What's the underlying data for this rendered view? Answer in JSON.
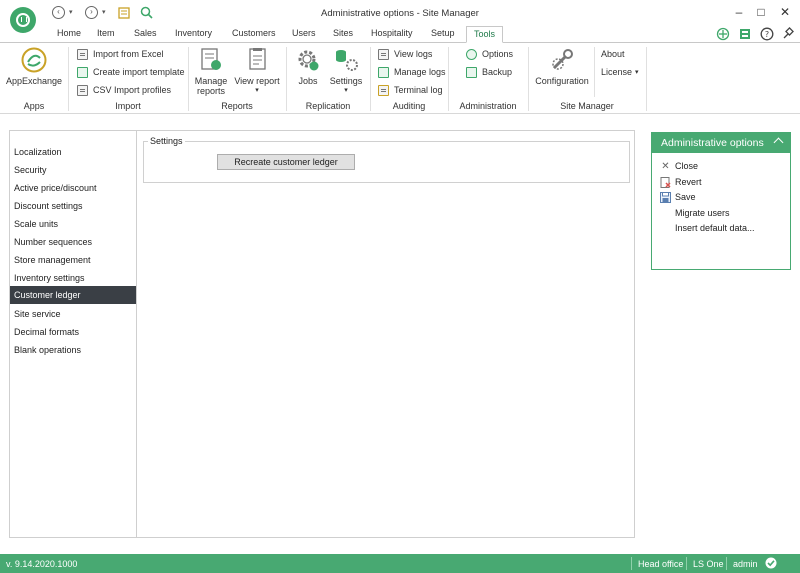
{
  "window": {
    "title": "Administrative options - Site Manager"
  },
  "ribbon": {
    "tabs": [
      "Home",
      "Item",
      "Sales",
      "Inventory",
      "Customers",
      "Users",
      "Sites",
      "Hospitality",
      "Setup",
      "Tools"
    ],
    "active_tab": "Tools",
    "groups": {
      "apps": {
        "label": "Apps",
        "appexchange": "AppExchange"
      },
      "import": {
        "label": "Import",
        "import_excel": "Import from Excel",
        "create_template": "Create import template",
        "csv_profiles": "CSV Import profiles"
      },
      "reports": {
        "label": "Reports",
        "manage_reports": "Manage\nreports",
        "manage_line1": "Manage",
        "manage_line2": "reports",
        "view_report": "View report"
      },
      "replication": {
        "label": "Replication",
        "jobs": "Jobs",
        "settings": "Settings"
      },
      "auditing": {
        "label": "Auditing",
        "view_logs": "View logs",
        "manage_logs": "Manage logs",
        "terminal_log": "Terminal log"
      },
      "administration": {
        "label": "Administration",
        "options": "Options",
        "backup": "Backup"
      },
      "site_manager": {
        "label": "Site Manager",
        "configuration": "Configuration",
        "about": "About",
        "license": "License"
      }
    }
  },
  "sidebar": {
    "items": [
      "Localization",
      "Security",
      "Active price/discount",
      "Discount settings",
      "Scale units",
      "Number sequences",
      "Store management",
      "Inventory settings",
      "Customer ledger",
      "Site service",
      "Decimal formats",
      "Blank operations"
    ],
    "active": "Customer ledger"
  },
  "content": {
    "group_title": "Settings",
    "recreate_button": "Recreate customer ledger"
  },
  "right_panel": {
    "title": "Administrative options",
    "actions": [
      "Close",
      "Revert",
      "Save",
      "Migrate users",
      "Insert default data..."
    ]
  },
  "status_bar": {
    "version": "v. 9.14.2020.1000",
    "site": "Head office",
    "product": "LS One",
    "user": "admin"
  },
  "colors": {
    "accent": "#48a972",
    "sidebar_active": "#3a3f45"
  }
}
